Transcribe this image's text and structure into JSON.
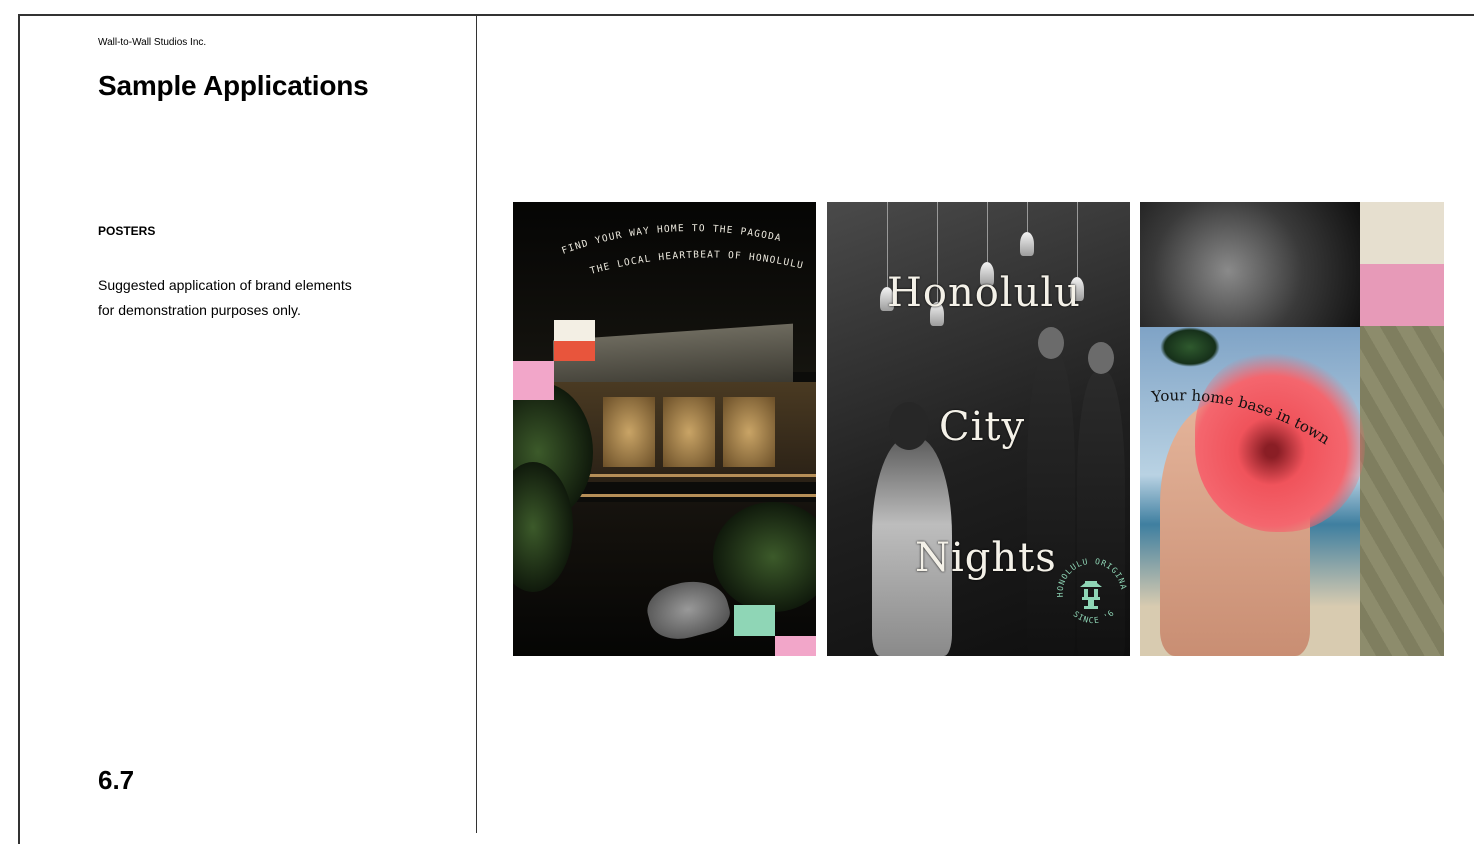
{
  "header": {
    "company": "Wall-to-Wall Studios Inc.",
    "title": "Sample Applications"
  },
  "section": {
    "label": "POSTERS",
    "description_line1": "Suggested application of brand elements",
    "description_line2": "for demonstration purposes only."
  },
  "page_number": "6.7",
  "posters": [
    {
      "name": "pagoda-night",
      "curved_line1": "FIND YOUR WAY HOME TO THE PAGODA",
      "curved_line2": "THE LOCAL HEARTBEAT OF HONOLULU",
      "colors": {
        "cream": "#f3efe4",
        "red": "#e8553c",
        "pink": "#f2a6c9",
        "mint": "#8fd6b6"
      }
    },
    {
      "name": "honolulu-city-nights",
      "words": [
        "Honolulu",
        "City",
        "Nights"
      ],
      "badge_top": "HONOLULU ORIGINAL",
      "badge_bottom": "SINCE '64",
      "badge_icon": "pagoda-lantern-icon",
      "colors": {
        "badge": "#8fd6b6"
      }
    },
    {
      "name": "home-base",
      "tagline": "Your home base in town",
      "colors": {
        "pink": "#e79ab8",
        "olive": "#8d8c6c",
        "paper": "#e6dfcf",
        "flower": "#f0535b"
      }
    }
  ]
}
